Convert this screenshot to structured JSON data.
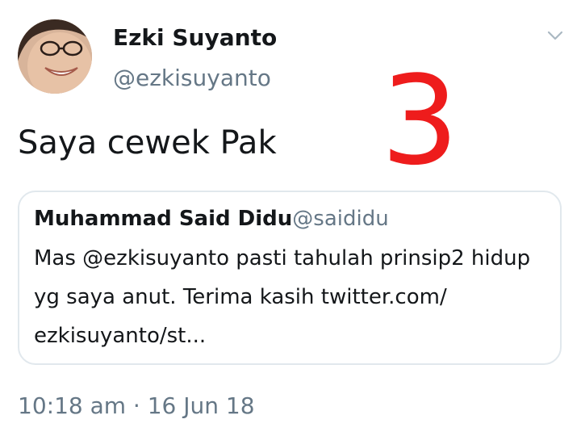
{
  "tweet": {
    "author": {
      "display_name": "Ezki Suyanto",
      "handle": "@ezkisuyanto",
      "avatar_icon": "person-photo-icon"
    },
    "menu_icon": "chevron-down-icon",
    "overlay_number": "3",
    "text": "Saya cewek Pak",
    "quoted_tweet": {
      "display_name": "Muhammad Said Didu",
      "handle": "@saididu",
      "body_lines": [
        "Mas @ezkisuyanto pasti tahulah prinsip2 hidup",
        "yg saya anut. Terima kasih twitter.com/",
        "ezkisuyanto/st..."
      ]
    },
    "timestamp": "10:18 am · 16 Jun 18"
  },
  "colors": {
    "text": "#14171a",
    "secondary": "#657786",
    "border": "#e1e8ed",
    "overlay": "#ee1c1c"
  }
}
